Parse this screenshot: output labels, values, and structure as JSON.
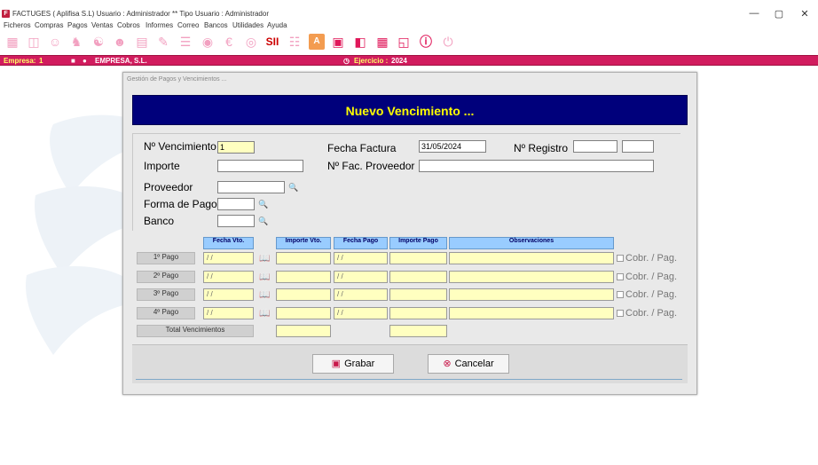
{
  "window": {
    "app_icon": "F",
    "title": "FACTUGES  ( Aplifisa S.L)   Usuario : Administrador  **  Tipo Usuario : Administrador",
    "minimize": "—",
    "restore": "▢",
    "close": "✕"
  },
  "menu": [
    "Ficheros",
    "Compras",
    "Pagos",
    "Ventas",
    "Cobros",
    "Informes",
    "Correo",
    "Bancos",
    "Utilidades",
    "Ayuda"
  ],
  "toolbar": {
    "icons": [
      "clients-icon",
      "suppliers-icon",
      "contacts-icon",
      "employee-icon",
      "groups-icon",
      "users-icon",
      "invoice-icon",
      "document-icon",
      "list-icon",
      "money-bag-icon",
      "euro-bag-icon",
      "sii-icon",
      "pdf-icon",
      "letter-a-icon",
      "calendar-icon",
      "monitors-icon",
      "calculator-icon",
      "folders-icon",
      "help-icon",
      "power-icon"
    ]
  },
  "statusbar": {
    "empresa_label": "Empresa:",
    "empresa_num": "1",
    "empresa_name": "EMPRESA, S.L.",
    "ejercicio_label": "Ejercicio :",
    "ejercicio_value": "2024"
  },
  "dialog": {
    "window_title": "Gestión de Pagos y Vencimientos ...",
    "banner": "Nuevo Vencimiento ...",
    "fields": {
      "n_vencimiento_label": "Nº Vencimiento",
      "n_vencimiento_value": "1",
      "fecha_factura_label": "Fecha Factura",
      "fecha_factura_value": "31/05/2024",
      "n_registro_label": "Nº Registro",
      "n_registro_value": "",
      "n_registro_value2": "",
      "importe_label": "Importe",
      "importe_value": "",
      "n_fac_proveedor_label": "Nº Fac. Proveedor",
      "n_fac_proveedor_value": "",
      "proveedor_label": "Proveedor",
      "proveedor_value": "",
      "forma_pago_label": "Forma de Pago",
      "forma_pago_value": "",
      "banco_label": "Banco",
      "banco_value": ""
    },
    "grid": {
      "headers": [
        "Fecha Vto.",
        "Importe Vto.",
        "Fecha Pago",
        "Importe Pago",
        "Observaciones"
      ],
      "rows": [
        {
          "label": "1º Pago",
          "fecha_vto": "/ /",
          "importe_vto": "",
          "fecha_pago": "/ /",
          "importe_pago": "",
          "observaciones": "",
          "check_label": "Cobr. / Pag."
        },
        {
          "label": "2º Pago",
          "fecha_vto": "/ /",
          "importe_vto": "",
          "fecha_pago": "/ /",
          "importe_pago": "",
          "observaciones": "",
          "check_label": "Cobr. / Pag."
        },
        {
          "label": "3º Pago",
          "fecha_vto": "/ /",
          "importe_vto": "",
          "fecha_pago": "/ /",
          "importe_pago": "",
          "observaciones": "",
          "check_label": "Cobr. / Pag."
        },
        {
          "label": "4º Pago",
          "fecha_vto": "/ /",
          "importe_vto": "",
          "fecha_pago": "/ /",
          "importe_pago": "",
          "observaciones": "",
          "check_label": "Cobr. / Pag."
        }
      ],
      "total_label": "Total Vencimientos",
      "total_importe_vto": "",
      "total_importe_pago": ""
    },
    "buttons": {
      "grabar": "Grabar",
      "cancelar": "Cancelar"
    }
  },
  "colors": {
    "statusbar_bg": "#d11c5e",
    "banner_bg": "#00007b",
    "banner_text": "#ffff00",
    "grid_header": "#99ccff",
    "input_yellow": "#ffffc0"
  }
}
